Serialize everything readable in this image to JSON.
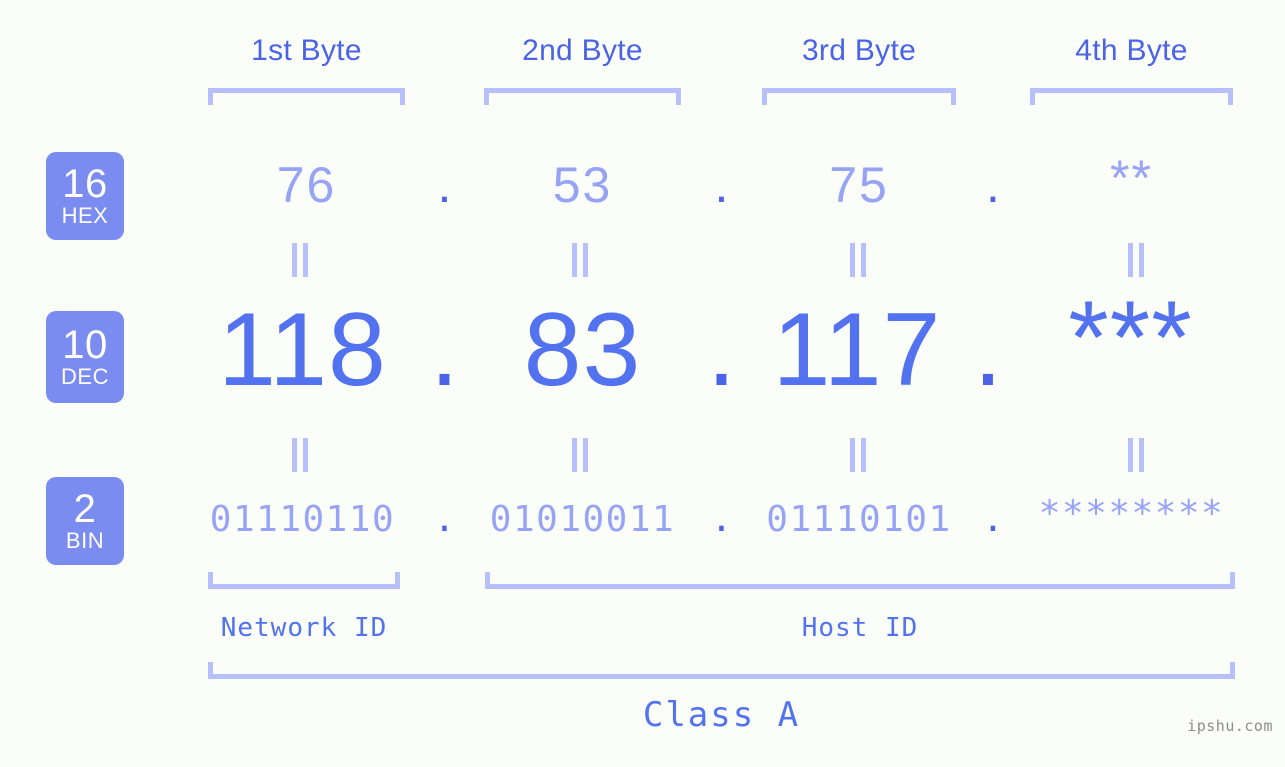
{
  "page": {
    "background_color": "#fbfdf8",
    "accent_color": "#5272ef",
    "accent_light_color": "#97a4f5",
    "bracket_color": "#b7c0fb",
    "badge_color": "#7a8cf0"
  },
  "byte_headers": [
    {
      "label": "1st Byte"
    },
    {
      "label": "2nd Byte"
    },
    {
      "label": "3rd Byte"
    },
    {
      "label": "4th Byte"
    }
  ],
  "radix_badges": [
    {
      "number": "16",
      "name": "HEX"
    },
    {
      "number": "10",
      "name": "DEC"
    },
    {
      "number": "2",
      "name": "BIN"
    }
  ],
  "rows": {
    "hex": {
      "values": [
        "76",
        "53",
        "75",
        "**"
      ],
      "separators": [
        ".",
        ".",
        "."
      ]
    },
    "dec": {
      "values": [
        "118",
        "83",
        "117",
        "***"
      ],
      "separators": [
        ".",
        ".",
        "."
      ]
    },
    "bin": {
      "values": [
        "01110110",
        "01010011",
        "01110101",
        "********"
      ],
      "separators": [
        ".",
        ".",
        "."
      ]
    }
  },
  "equality_marks": {
    "symbol": "=",
    "count_per_row": 4
  },
  "sections": [
    {
      "caption": "Network ID"
    },
    {
      "caption": "Host ID"
    }
  ],
  "class_caption": "Class A",
  "watermark": "ipshu.com"
}
